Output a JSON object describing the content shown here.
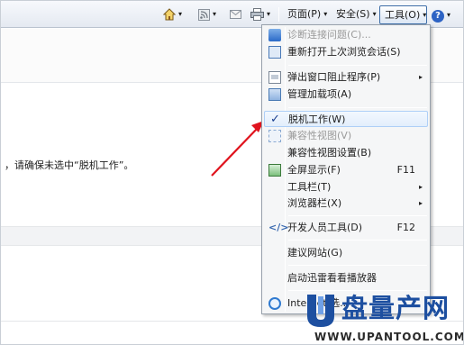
{
  "toolbar": {
    "home_arrow": "▾",
    "rss_arrow": "▾",
    "print_arrow": "▾",
    "page_label": "页面(P)",
    "safety_label": "安全(S)",
    "tools_label": "工具(O)",
    "help_symbol": "?",
    "dropdown_arrow": "▾"
  },
  "content": {
    "sentence": "，请确保未选中“脱机工作”。"
  },
  "menu": {
    "items": [
      {
        "label": "诊断连接问题(C)...",
        "shortcut": "",
        "disabled": true,
        "icon": "network-diagnose-icon"
      },
      {
        "label": "重新打开上次浏览会话(S)",
        "shortcut": "",
        "icon": "reopen-session-icon"
      },
      {
        "label": "弹出窗口阻止程序(P)",
        "shortcut": "",
        "submenu": "▸",
        "icon": "popup-blocker-icon"
      },
      {
        "label": "管理加载项(A)",
        "shortcut": "",
        "icon": "manage-addons-icon"
      },
      {
        "label": "脱机工作(W)",
        "shortcut": "",
        "checked": true,
        "highlighted": true,
        "check": "✓"
      },
      {
        "label": "兼容性视图(V)",
        "shortcut": "",
        "disabled": true,
        "icon": "compat-view-icon"
      },
      {
        "label": "兼容性视图设置(B)",
        "shortcut": ""
      },
      {
        "label": "全屏显示(F)",
        "shortcut": "F11",
        "icon": "fullscreen-icon"
      },
      {
        "label": "工具栏(T)",
        "shortcut": "",
        "submenu": "▸"
      },
      {
        "label": "浏览器栏(X)",
        "shortcut": "",
        "submenu": "▸"
      },
      {
        "label": "开发人员工具(D)",
        "shortcut": "F12",
        "icon": "developer-tools-icon"
      },
      {
        "label": "建议网站(G)",
        "shortcut": ""
      },
      {
        "label": "启动迅雷看看播放器",
        "shortcut": ""
      },
      {
        "label": "Internet 选...",
        "shortcut": "",
        "icon": "internet-options-icon"
      }
    ]
  },
  "watermark": {
    "logo_text": "盘量产网",
    "url": "WWW.UPANTOOL.COM"
  },
  "colors": {
    "accent": "#1d4fa0",
    "arrow": "#e0141e",
    "menu_highlight": "#e2eefc"
  }
}
